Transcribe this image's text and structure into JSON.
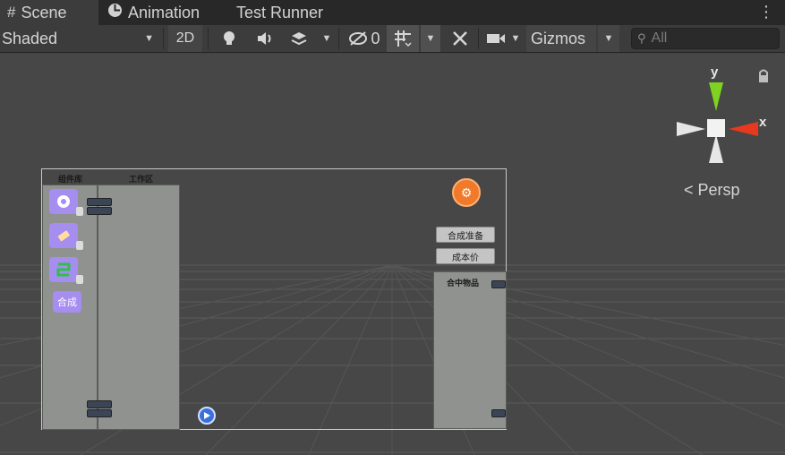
{
  "tabs": [
    {
      "label": "Scene",
      "icon": "grid-hash-icon",
      "active": true
    },
    {
      "label": "Animation",
      "icon": "animation-clock-icon",
      "active": false
    },
    {
      "label": "Test Runner",
      "icon": "",
      "active": false
    }
  ],
  "toolbar": {
    "draw_mode": "Shaded",
    "mode_2d": "2D",
    "hidden_count": "0",
    "gizmos": "Gizmos",
    "search_placeholder": "All"
  },
  "gizmo": {
    "axis_y": "y",
    "axis_x": "x",
    "projection": "Persp"
  },
  "game_ui": {
    "left_panel_label": "组件库",
    "work_panel_label": "工作区",
    "component_buttons": [
      "",
      "",
      "",
      "合成"
    ],
    "action_buttons": [
      "合成准备",
      "成本价"
    ],
    "right_panel_label": "合中物品"
  },
  "colors": {
    "viewport_bg": "#474747",
    "axis_y": "#7ed321",
    "axis_x": "#e8391e",
    "accent_orange": "#f07a2a",
    "component_purple": "#a68df0"
  }
}
